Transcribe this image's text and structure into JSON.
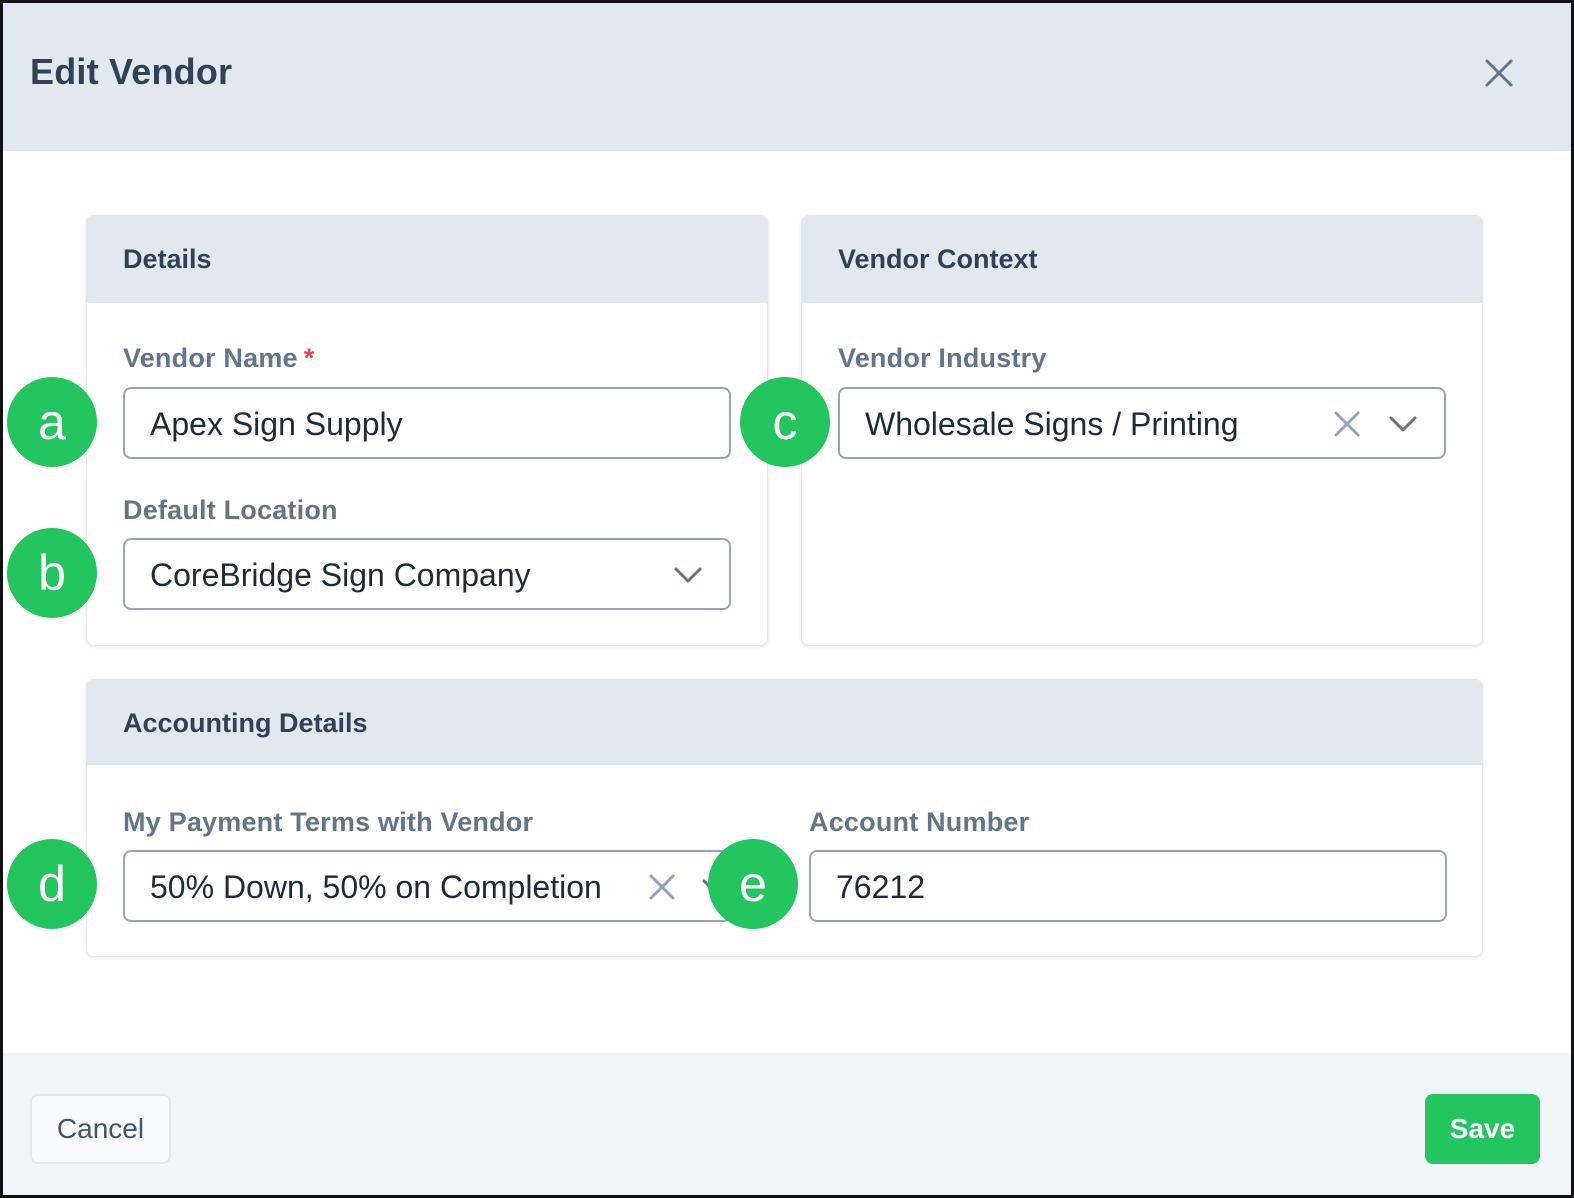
{
  "dialog": {
    "title": "Edit Vendor"
  },
  "details": {
    "title": "Details",
    "vendor_name": {
      "label": "Vendor Name",
      "required_marker": "*",
      "value": "Apex Sign Supply"
    },
    "default_location": {
      "label": "Default Location",
      "value": "CoreBridge Sign Company"
    }
  },
  "vendor_context": {
    "title": "Vendor Context",
    "vendor_industry": {
      "label": "Vendor Industry",
      "value": "Wholesale Signs / Printing"
    }
  },
  "accounting": {
    "title": "Accounting Details",
    "payment_terms": {
      "label": "My Payment Terms with Vendor",
      "value": "50% Down, 50% on Completion"
    },
    "account_number": {
      "label": "Account Number",
      "value": "76212"
    }
  },
  "callouts": [
    "a",
    "b",
    "c",
    "d",
    "e"
  ],
  "footer": {
    "cancel_label": "Cancel",
    "save_label": "Save"
  },
  "colors": {
    "header_bg": "#e2e8f0",
    "accent_green": "#22c55e",
    "required_red": "#ef4444",
    "label_gray": "#64748b"
  },
  "icons": [
    "close-icon",
    "clear-icon",
    "chevron-down-icon"
  ]
}
